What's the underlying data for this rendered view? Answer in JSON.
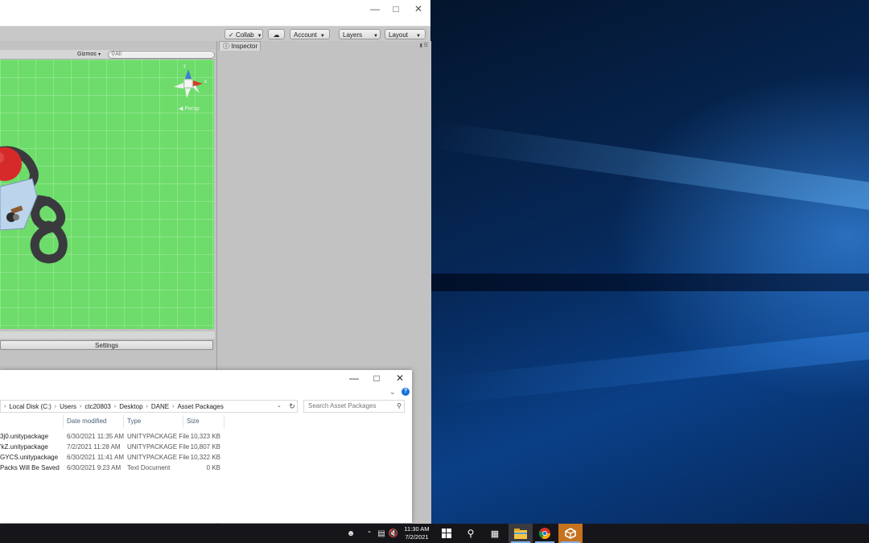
{
  "unity": {
    "toolbar": {
      "collab": "Collab",
      "account": "Account",
      "layers": "Layers",
      "layout": "Layout"
    },
    "scene": {
      "gizmos": "Gizmos",
      "search_placeholder": "All",
      "persp": "Persp",
      "axis_x": "x",
      "axis_z": "z"
    },
    "settings_label": "Settings",
    "inspector_tab": "Inspector"
  },
  "explorer": {
    "breadcrumb": [
      "Local Disk (C:)",
      "Users",
      "ctc20803",
      "Desktop",
      "DANE",
      "Asset Packages"
    ],
    "search_placeholder": "Search Asset Packages",
    "columns": {
      "date": "Date modified",
      "type": "Type",
      "size": "Size"
    },
    "files": [
      {
        "name": "3j0.unitypackage",
        "date": "6/30/2021 11:35 AM",
        "type": "UNITYPACKAGE File",
        "size": "10,323 KB"
      },
      {
        "name": "'kZ.unitypackage",
        "date": "7/2/2021 11:28 AM",
        "type": "UNITYPACKAGE File",
        "size": "10,807 KB"
      },
      {
        "name": "GYCS.unitypackage",
        "date": "6/30/2021 11:41 AM",
        "type": "UNITYPACKAGE File",
        "size": "10,322 KB"
      },
      {
        "name": "Packs Will Be Saved",
        "date": "6/30/2021 9:23 AM",
        "type": "Text Document",
        "size": "0 KB"
      }
    ]
  },
  "taskbar": {
    "time": "11:30 AM",
    "date": "7/2/2021",
    "apps": [
      "start",
      "search",
      "task-view",
      "file-explorer",
      "chrome",
      "unity"
    ]
  }
}
